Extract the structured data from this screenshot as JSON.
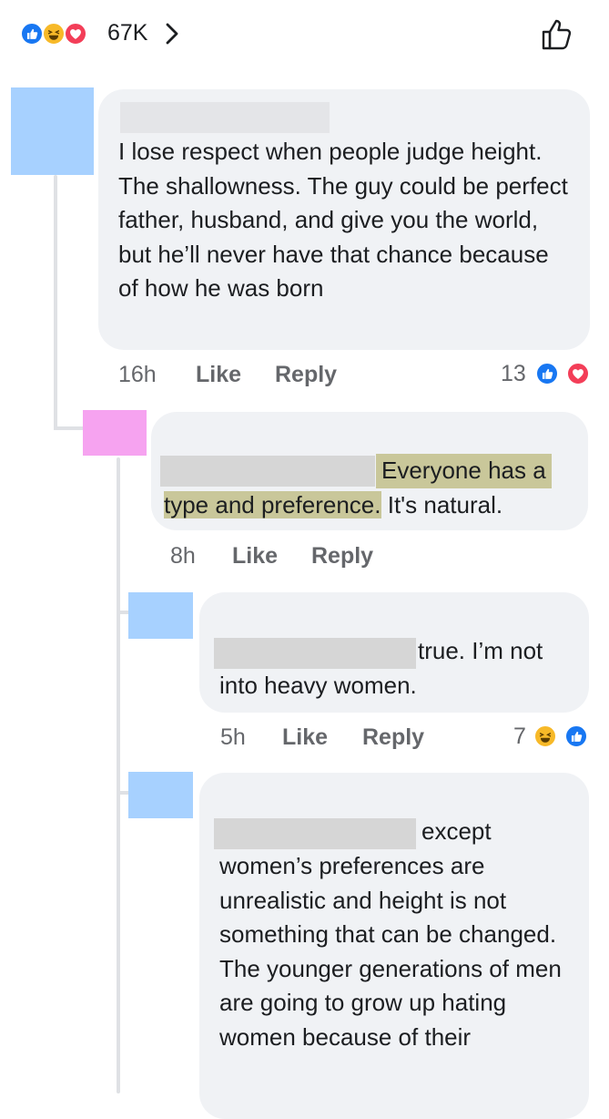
{
  "header": {
    "reaction_count": "67K",
    "reactions": [
      "like-icon",
      "haha-icon",
      "love-icon"
    ]
  },
  "comments": [
    {
      "text": "I lose respect when people judge height.  The shallowness.  The guy could be perfect father, husband, and give you the world, but he’ll never have that chance because of how he was born",
      "time": "16h",
      "like": "Like",
      "reply": "Reply",
      "reaction_count": "13",
      "avatar_color": "#a7d1ff"
    },
    {
      "text_highlighted_1": "Everyone has a",
      "text_highlighted_2": "type and preference.",
      "text_rest": " It's natural.",
      "time": "8h",
      "like": "Like",
      "reply": "Reply",
      "avatar_color": "#f6a3f0"
    },
    {
      "text_line1": "true. I’m not",
      "text_line2": "into heavy women.",
      "time": "5h",
      "like": "Like",
      "reply": "Reply",
      "reaction_count": "7",
      "avatar_color": "#a7d1ff"
    },
    {
      "text_line1": "except",
      "text_rest": "women’s preferences are unrealistic and height is not something that can be changed. The younger generations of men are going to grow up hating women because of their",
      "avatar_color": "#a7d1ff"
    }
  ],
  "colors": {
    "bubble": "#f0f2f5",
    "like_blue": "#1877f2",
    "love_red": "#f33e58",
    "haha_yellow": "#f7b928",
    "meta_gray": "#65676b",
    "highlight": "#c9c79a"
  }
}
